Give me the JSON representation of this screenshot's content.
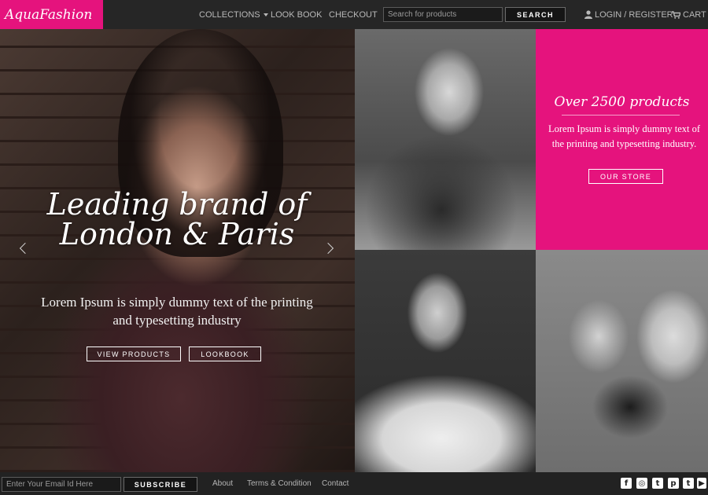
{
  "brand": {
    "logo_text": "AquaFashion",
    "accent_color": "#e5137d"
  },
  "nav": {
    "collections": "COLLECTIONS",
    "lookbook": "LOOK BOOK",
    "checkout": "CHECKOUT",
    "search_placeholder": "Search for products",
    "search_button": "SEARCH",
    "login": "LOGIN / REGISTER",
    "cart": "CART"
  },
  "hero": {
    "title": "Leading brand of London & Paris",
    "subtitle": "Lorem Ipsum is simply dummy text of the printing and typesetting industry",
    "btn_products": "VIEW PRODUCTS",
    "btn_lookbook": "LOOKBOOK"
  },
  "promo": {
    "title": "Over 2500 products",
    "text": "Lorem Ipsum is simply dummy text of the printing and typesetting industry.",
    "button": "OUR STORE"
  },
  "footer": {
    "email_placeholder": "Enter Your Email Id Here",
    "subscribe": "SUBSCRIBE",
    "about": "About",
    "terms": "Terms & Condition",
    "contact": "Contact"
  },
  "social_icons": [
    "facebook-icon",
    "instagram-icon",
    "twitter-icon",
    "pinterest-icon",
    "tumblr-icon",
    "youtube-icon"
  ]
}
